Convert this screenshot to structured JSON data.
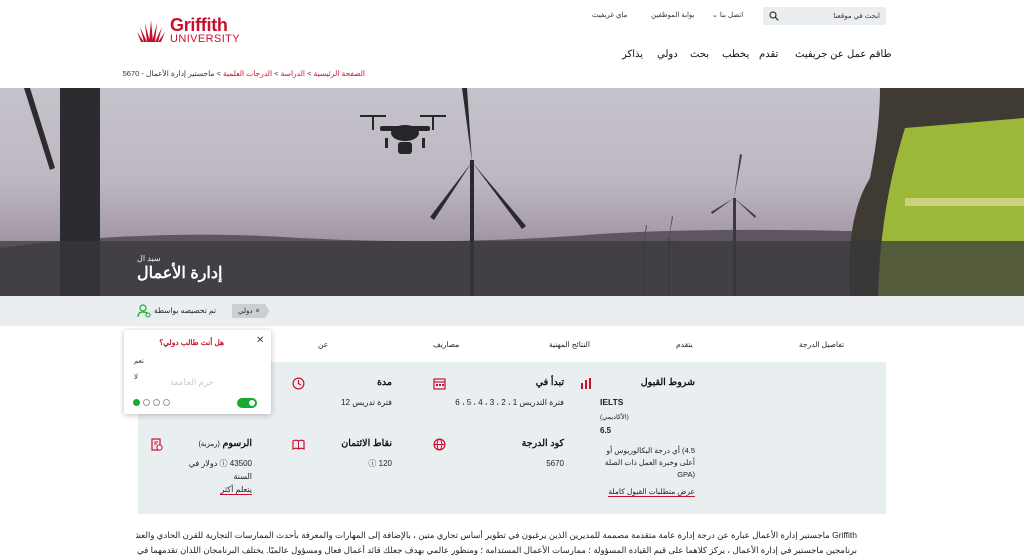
{
  "header": {
    "logo_line1": "Griffith",
    "logo_line2": "UNIVERSITY",
    "utility_links": [
      "ماي غريفيث",
      "بوابة الموظفين",
      "اتصل بنا"
    ],
    "utility_arrow": "⌄",
    "search_placeholder": "ابحث في موقعنا",
    "nav": [
      "طاقم عمل",
      "عن جريفيث",
      "تقدم",
      "يخطب",
      "بحث",
      "دولي",
      "يذاكر"
    ]
  },
  "breadcrumb": {
    "home": "الصفحة الرئيسية",
    "study": "الدراسة",
    "degrees": "الدرجات العلمية",
    "current": "ماجستير إدارة الأعمال - 5670",
    "separator": ">"
  },
  "hero": {
    "subtitle": "سيد ال",
    "title": "إدارة الأعمال"
  },
  "personalise": {
    "text": "تم تخصيصه بواسطة",
    "tag": "دولي",
    "tag_close": "×"
  },
  "tabs": [
    "تفاصيل الدرجة",
    "يتقدم",
    "النتائج المهنية",
    "مصاريف",
    "عن"
  ],
  "facts": {
    "entry": {
      "title": "شروط القبول",
      "ielts": "IELTS",
      "academic": "(الأكاديمي)",
      "score": "6.5",
      "note": "4.5) أي درجة البكالوريوس أو أعلى وخبرة العمل ذات الصلة (GPA",
      "link": "عرض متطلبات القبول كاملة"
    },
    "start": {
      "title": "تبدأ في",
      "value": "فترة التدريس 1 ، 2 ، 3 ، 4 ، 5 ، 6"
    },
    "duration": {
      "title": "مدة",
      "value": "فترة تدريس 12"
    },
    "code": {
      "title": "كود الدرجة",
      "value": "5670"
    },
    "credits": {
      "title": "نقاط الائتمان",
      "value": "120 ⓘ"
    },
    "fees": {
      "title": "الرسوم",
      "title_suffix": "(رمزية)",
      "value": "43500 ⓘ دولار في السنة",
      "link": "يتعلم أكثر"
    }
  },
  "popup": {
    "close": "✕",
    "question": "هل أنت طالب دولي؟",
    "yes": "نعم",
    "no": "لا",
    "ghost_text": "حرم الجامعة"
  },
  "intro": {
    "line1": "Griffith ماجستير إدارة الأعمال عبارة عن درجة إدارة عامة متقدمة مصممة للمديرين الذين يرغبون في تطوير أساس تجاري متين ، بالإضافة إلى المهارات والمعرفة بأحدث الممارسات التجارية للقرن الحادي والعشرين. تقدم في",
    "line2": "برنامجين ماجستير في إدارة الأعمال ، يركز كلاهما على قيم القيادة المسؤولة ؛ ممارسات الأعمال المستدامة ؛ ومنظور عالمي بهدف جعلك قائد أعمال فعال ومسؤول عالميًا. يختلف البرنامجان اللذان تقدمهما في أسلوب تقديمهما ، واحد"
  },
  "colors": {
    "brand_red": "#c8102e",
    "toggle_green": "#1aa832"
  }
}
